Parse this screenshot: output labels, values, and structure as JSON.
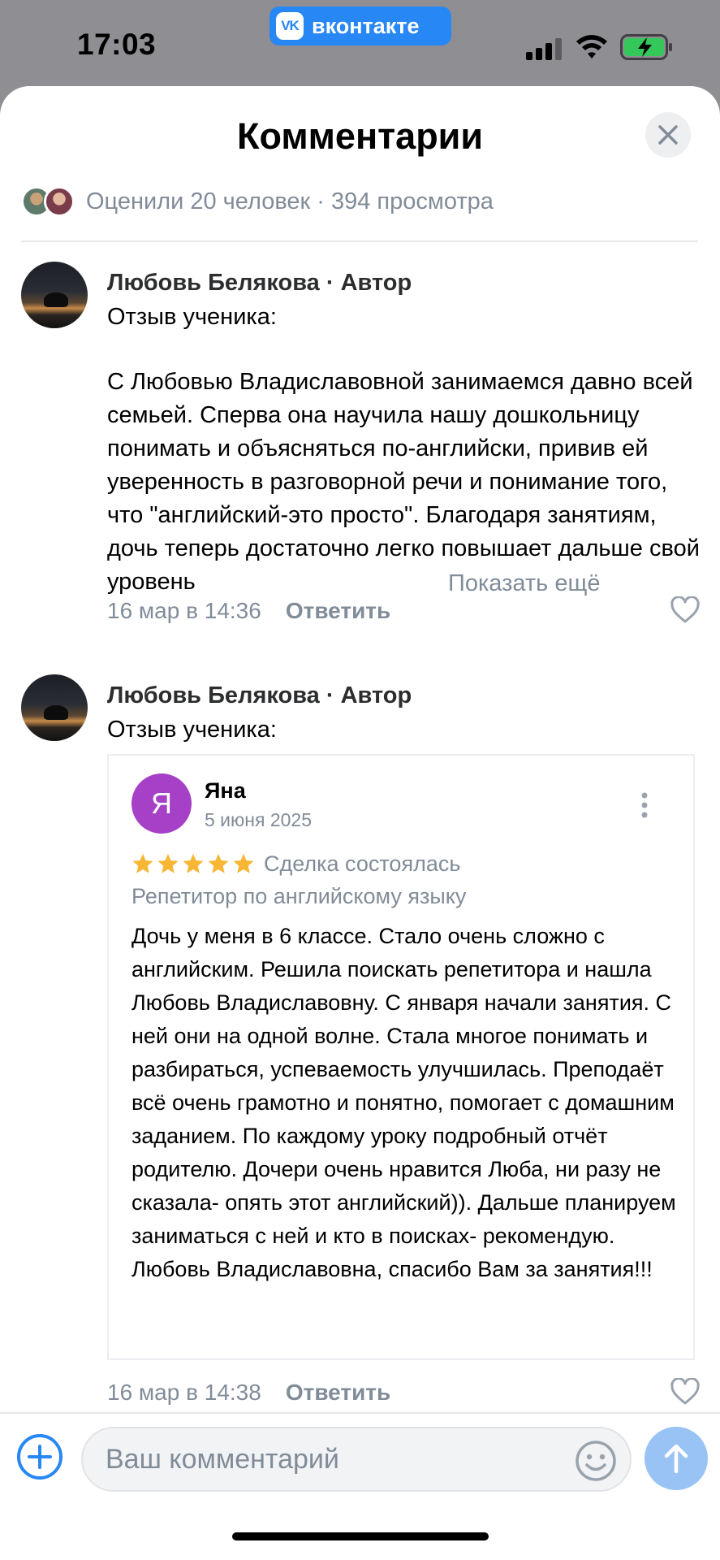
{
  "status_bar": {
    "time": "17:03",
    "app_pill": {
      "logo": "VK",
      "label": "вконтакте"
    },
    "icons": [
      "signal-icon",
      "wifi-icon",
      "battery-charging-icon"
    ]
  },
  "sheet": {
    "title": "Комментарии",
    "close_icon": "close-icon",
    "stats": "Оценили 20 человек · 394 просмотра"
  },
  "comments": [
    {
      "author": "Любовь Белякова · Автор",
      "subtitle": "Отзыв ученика:",
      "text": "С Любовью Владиславовной занимаемся давно всей семьей. Сперва она научила нашу дошкольницу понимать и объясняться по-английски, привив ей уверенность в разговорной речи и понимание того, что \"английский-это просто\". Благодаря занятиям, дочь теперь достаточно легко повышает дальше свой уровень",
      "show_more": "Показать ещё",
      "date": "16 мар в 14:36",
      "reply_label": "Ответить",
      "like_icon": "heart-icon"
    },
    {
      "author": "Любовь Белякова · Автор",
      "subtitle": "Отзыв ученика:",
      "review": {
        "avatar_letter": "Я",
        "avatar_color": "#a640c6",
        "name": "Яна",
        "date": "5 июня 2025",
        "rating": 5,
        "status": "Сделка состоялась",
        "category": "Репетитор по английскому языку",
        "text": "Дочь у меня в 6 классе. Стало очень сложно с английским. Решила поискать репетитора и нашла Любовь Владиславовну. С января начали занятия. С ней они на одной волне. Стала многое понимать и разбираться, успеваемость улучшилась. Преподаёт всё очень грамотно и понятно, помогает с домашним заданием. По каждому уроку подробный отчёт родителю. Дочери очень нравится Люба, ни разу не сказала- опять этот английский)). Дальше планируем заниматься с ней и кто в поисках- рекомендую. Любовь Владиславовна, спасибо Вам за занятия!!!"
      },
      "date": "16 мар в 14:38",
      "reply_label": "Ответить",
      "like_icon": "heart-icon"
    }
  ],
  "composer": {
    "placeholder": "Ваш комментарий",
    "value": "",
    "icons": [
      "plus-circle-icon",
      "smile-icon",
      "arrow-up-icon"
    ]
  },
  "colors": {
    "accent": "#2787f5",
    "secondary_text": "#818c99",
    "star": "#f7b633",
    "review_avatar": "#a640c6",
    "send_disabled": "#99c2f5"
  }
}
